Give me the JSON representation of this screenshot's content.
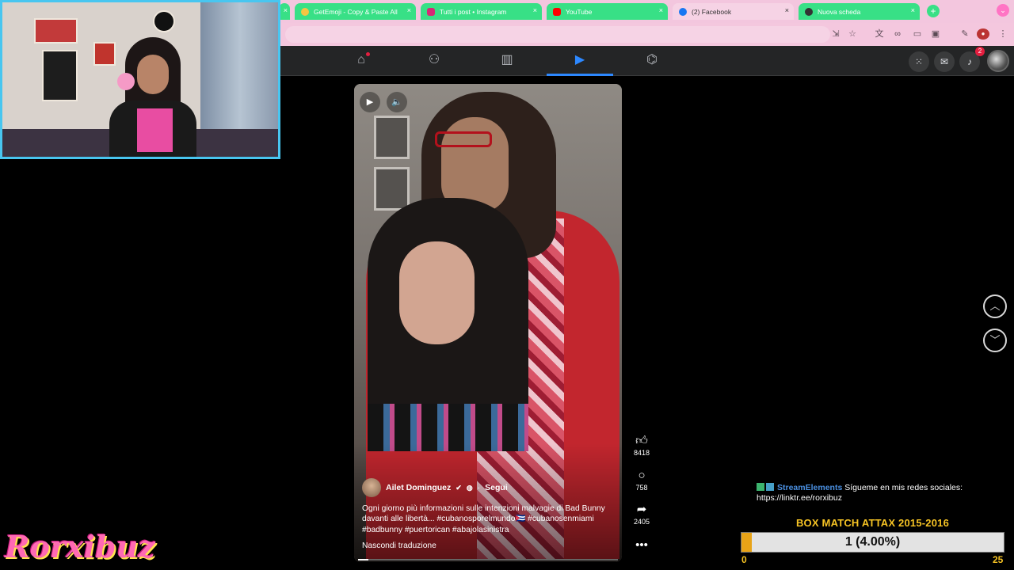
{
  "browser": {
    "tabs": [
      {
        "title": "GetEmoji - Copy & Paste All",
        "favicon_color": "#f5c542"
      },
      {
        "title": "Tutti i post • Instagram",
        "favicon_color": "#d62976"
      },
      {
        "title": "YouTube",
        "favicon_color": "#ff0000"
      },
      {
        "title": "(2) Facebook",
        "favicon_color": "#1877f2"
      },
      {
        "title": "Nuova scheda",
        "favicon_color": "#333333"
      }
    ],
    "new_tab_symbol": "+",
    "close_symbol": "×"
  },
  "facebook": {
    "nav_items": [
      "home-icon",
      "friends-icon",
      "feeds-icon",
      "reels-icon",
      "marketplace-icon"
    ],
    "active_nav": "reels-icon",
    "notification_count": "2",
    "accent_color": "#2d88ff"
  },
  "reel": {
    "author": "Ailet Dominguez",
    "follow_label": "Segui",
    "caption": "Ogni giorno più informazioni sulle intenzioni malvagie di Bad Bunny davanti alle libertà... #cubanosporelmundo🇨🇺 #cubanosenmiami #badbunny #puertorican #abajolasinistra",
    "translation_toggle": "Nascondi traduzione",
    "likes": "8418",
    "comments": "758",
    "shares": "2405",
    "progress_fraction": 0.04
  },
  "stream": {
    "chat": {
      "user": "StreamElements",
      "message": "Sígueme en mis redes sociales: https://linktr.ee/rorxibuz"
    },
    "goal": {
      "title": "BOX MATCH ATTAX 2015-2016",
      "progress_text": "1 (4.00%)",
      "current": 1,
      "min_label": "0",
      "max_label": "25",
      "fraction": 0.04,
      "bar_color": "#e8a317",
      "title_color": "#f6c324"
    },
    "brand": "Rorxibuz"
  }
}
